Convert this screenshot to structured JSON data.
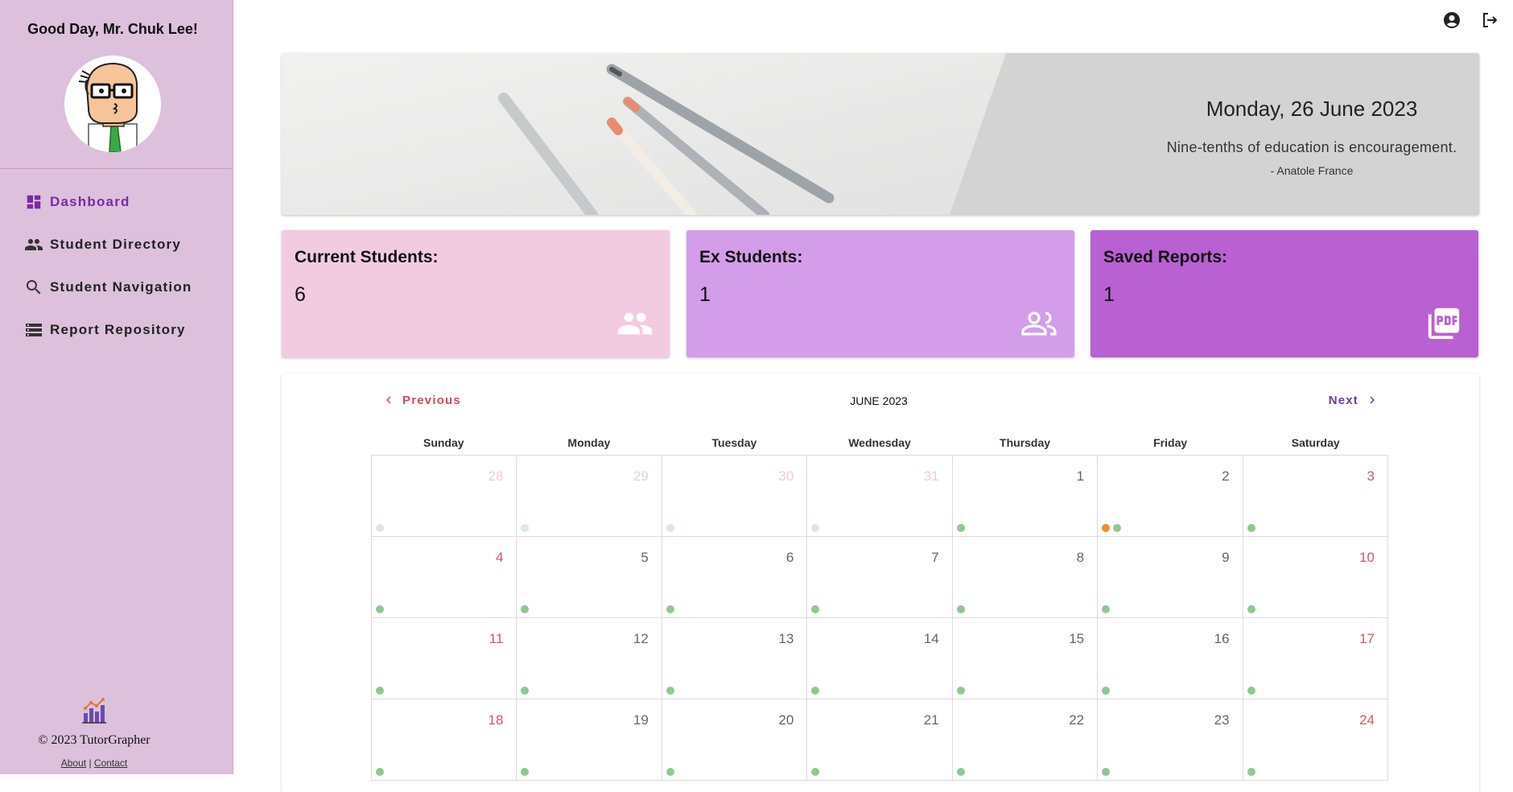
{
  "sidebar": {
    "greeting": "Good Day, Mr. Chuk Lee!",
    "nav": [
      {
        "label": "Dashboard",
        "icon": "dashboard-icon",
        "active": true
      },
      {
        "label": "Student Directory",
        "icon": "people-icon",
        "active": false
      },
      {
        "label": "Student Navigation",
        "icon": "search-icon",
        "active": false
      },
      {
        "label": "Report Repository",
        "icon": "storage-list-icon",
        "active": false
      }
    ],
    "footer": {
      "copyright": "© 2023 TutorGrapher",
      "about": "About",
      "separator": "|",
      "contact": "Contact"
    }
  },
  "header": {
    "account_icon": "account-circle-icon",
    "logout_icon": "logout-icon"
  },
  "banner": {
    "date": "Monday, 26 June 2023",
    "quote": "Nine-tenths of education is encouragement.",
    "author": "- Anatole France"
  },
  "stats": [
    {
      "title": "Current Students:",
      "value": "6",
      "icon": "group-icon",
      "color": "#f3cbe1"
    },
    {
      "title": "Ex Students:",
      "value": "1",
      "icon": "group-outline-icon",
      "color": "#d39dea"
    },
    {
      "title": "Saved Reports:",
      "value": "1",
      "icon": "pdf-icon",
      "color": "#b960d2"
    }
  ],
  "calendar": {
    "prev_label": "Previous",
    "next_label": "Next",
    "month_label": "JUNE 2023",
    "weekdays": [
      "Sunday",
      "Monday",
      "Tuesday",
      "Wednesday",
      "Thursday",
      "Friday",
      "Saturday"
    ],
    "weeks": [
      [
        {
          "day": "28",
          "other": true,
          "dots": [
            "green"
          ]
        },
        {
          "day": "29",
          "other": true,
          "dots": [
            "green"
          ]
        },
        {
          "day": "30",
          "other": true,
          "dots": [
            "green"
          ]
        },
        {
          "day": "31",
          "other": true,
          "dots": [
            "green"
          ]
        },
        {
          "day": "1",
          "other": false,
          "dots": [
            "green"
          ]
        },
        {
          "day": "2",
          "other": false,
          "dots": [
            "orange",
            "green"
          ]
        },
        {
          "day": "3",
          "other": false,
          "dots": [
            "green"
          ]
        }
      ],
      [
        {
          "day": "4",
          "other": false,
          "dots": [
            "green"
          ]
        },
        {
          "day": "5",
          "other": false,
          "dots": [
            "green"
          ]
        },
        {
          "day": "6",
          "other": false,
          "dots": [
            "green"
          ]
        },
        {
          "day": "7",
          "other": false,
          "dots": [
            "green"
          ]
        },
        {
          "day": "8",
          "other": false,
          "dots": [
            "green"
          ]
        },
        {
          "day": "9",
          "other": false,
          "dots": [
            "green"
          ]
        },
        {
          "day": "10",
          "other": false,
          "dots": [
            "green"
          ]
        }
      ],
      [
        {
          "day": "11",
          "other": false,
          "dots": [
            "green"
          ]
        },
        {
          "day": "12",
          "other": false,
          "dots": [
            "green"
          ]
        },
        {
          "day": "13",
          "other": false,
          "dots": [
            "green"
          ]
        },
        {
          "day": "14",
          "other": false,
          "dots": [
            "green"
          ]
        },
        {
          "day": "15",
          "other": false,
          "dots": [
            "green"
          ]
        },
        {
          "day": "16",
          "other": false,
          "dots": [
            "green"
          ]
        },
        {
          "day": "17",
          "other": false,
          "dots": [
            "green"
          ]
        }
      ],
      [
        {
          "day": "18",
          "other": false,
          "dots": [
            "green"
          ]
        },
        {
          "day": "19",
          "other": false,
          "dots": [
            "green"
          ]
        },
        {
          "day": "20",
          "other": false,
          "dots": [
            "green"
          ]
        },
        {
          "day": "21",
          "other": false,
          "dots": [
            "green"
          ]
        },
        {
          "day": "22",
          "other": false,
          "dots": [
            "green"
          ]
        },
        {
          "day": "23",
          "other": false,
          "dots": [
            "green"
          ]
        },
        {
          "day": "24",
          "other": false,
          "dots": [
            "green"
          ]
        }
      ]
    ]
  },
  "colors": {
    "sidebar_bg": "#dcc0dc",
    "active_nav": "#7b2aa3",
    "weekend_day": "#d0575f",
    "event_dot_green": "#8fc98f",
    "event_dot_orange": "#f28c28",
    "prev_button": "#e0445a",
    "next_button": "#6b3fa0"
  }
}
